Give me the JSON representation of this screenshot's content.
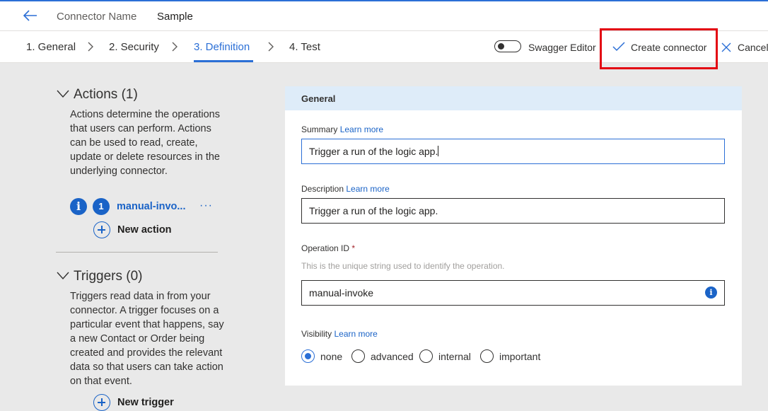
{
  "header": {
    "connector_name_label": "Connector Name",
    "connector_name_value": "Sample"
  },
  "steps": [
    {
      "label": "1. General"
    },
    {
      "label": "2. Security"
    },
    {
      "label": "3. Definition",
      "active": true
    },
    {
      "label": "4. Test"
    }
  ],
  "toolbar": {
    "swagger_label": "Swagger Editor",
    "swagger_on": false,
    "create_label": "Create connector",
    "cancel_label": "Cancel"
  },
  "actions": {
    "title": "Actions (1)",
    "description": "Actions determine the operations that users can perform. Actions can be used to read, create, update or delete resources in the underlying connector.",
    "item_number": "1",
    "item_label": "manual-invo...",
    "more": "···",
    "new_label": "New action"
  },
  "triggers": {
    "title": "Triggers (0)",
    "description": "Triggers read data in from your connector. A trigger focuses on a particular event that happens, say a new Contact or Order being created and provides the relevant data so that users can take action on that event.",
    "new_label": "New trigger"
  },
  "form": {
    "section_title": "General",
    "summary_label": "Summary",
    "summary_learn": "Learn more",
    "summary_value": "Trigger a run of the logic app.",
    "description_label": "Description",
    "description_learn": "Learn more",
    "description_value": "Trigger a run of the logic app.",
    "operation_label": "Operation ID",
    "operation_required": "*",
    "operation_hint": "This is the unique string used to identify the operation.",
    "operation_value": "manual-invoke",
    "visibility_label": "Visibility",
    "visibility_learn": "Learn more",
    "visibility_options": [
      "none",
      "advanced",
      "internal",
      "important"
    ],
    "visibility_selected": "none"
  },
  "colors": {
    "accent": "#2b6fd6",
    "highlight": "#e30613"
  }
}
